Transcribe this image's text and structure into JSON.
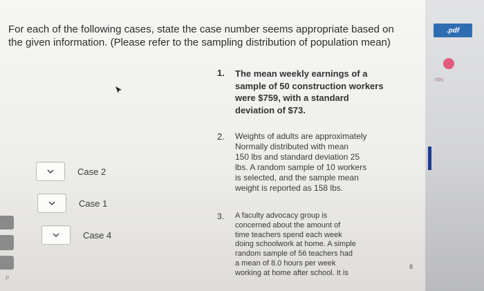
{
  "question": {
    "text": "For each of the following cases, state the case number seems appropriate based on\nthe given information. (Please refer to the sampling distribution of population mean)"
  },
  "cases": [
    {
      "label": "Case 2"
    },
    {
      "label": "Case 1"
    },
    {
      "label": "Case 4"
    }
  ],
  "items": [
    {
      "number": "1.",
      "text": "The mean weekly earnings of a\nsample of 50 construction workers\nwere $759, with a standard\ndeviation of $73."
    },
    {
      "number": "2.",
      "text": "Weights of adults are approximately\nNormally distributed with mean\n150 lbs and standard deviation 25\nlbs. A random sample of 10 workers\nis selected, and the sample mean\nweight is reported as 158 lbs."
    },
    {
      "number": "3.",
      "text": "A faculty advocacy group is\nconcerned about the amount of\ntime teachers spend each week\ndoing schoolwork at home. A simple\nrandom sample of 56 teachers had\na mean of 8.0 hours per week\nworking at home after school. It is"
    }
  ],
  "sidebar": {
    "pdf_label": ".pdf",
    "pts_label": "nts",
    "p_label": "P",
    "page_number": "8"
  },
  "colors": {
    "accent": "#2f6db3",
    "pink": "#e35a7f",
    "navy": "#1d3c8f"
  }
}
